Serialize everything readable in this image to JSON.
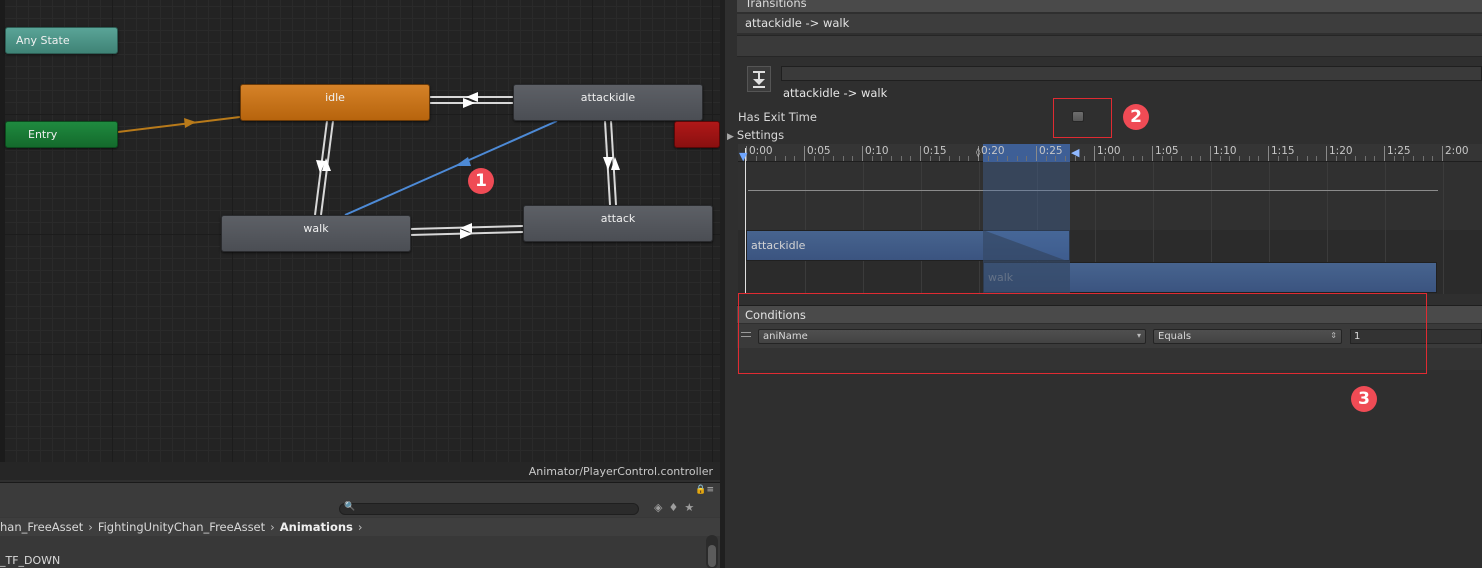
{
  "graph": {
    "nodes": {
      "any_state": "Any State",
      "entry": "Entry",
      "idle": "idle",
      "attackidle": "attackidle",
      "walk": "walk",
      "attack": "attack"
    },
    "footer_path": "Animator/PlayerControl.controller"
  },
  "project": {
    "breadcrumb": [
      "han_FreeAsset",
      "FightingUnityChan_FreeAsset",
      "Animations"
    ],
    "list_item": "_TF_DOWN"
  },
  "inspector": {
    "transitions_header": "Transitions",
    "transition_item": "attackidle -> walk",
    "title": "attackidle -> walk",
    "has_exit_time_label": "Has Exit Time",
    "has_exit_time_checked": false,
    "settings_label": "Settings",
    "timeline": {
      "ticks": [
        "0:00",
        "0:05",
        "0:10",
        "0:15",
        "0:20",
        "0:25",
        "1:00",
        "1:05",
        "1:10",
        "1:15",
        "1:20",
        "1:25",
        "2:00"
      ],
      "clips": {
        "source": "attackidle",
        "destination": "walk"
      }
    },
    "conditions": {
      "header": "Conditions",
      "parameter": "aniName",
      "mode": "Equals",
      "value": "1"
    }
  },
  "annotations": {
    "badge_1": "1",
    "badge_2": "2",
    "badge_3": "3",
    "color": "#ef4b55"
  }
}
